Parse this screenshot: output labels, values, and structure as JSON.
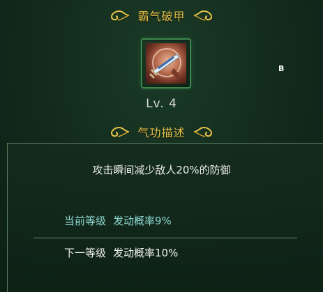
{
  "header": {
    "title": "霸气破甲"
  },
  "skill": {
    "icon": "sword-icon",
    "level": "Lv. 4"
  },
  "marker": "B",
  "section": {
    "title": "气功描述"
  },
  "description": "攻击瞬间减少敌人20%的防御",
  "current": {
    "label": "当前等级",
    "value": "发动概率9%"
  },
  "next": {
    "label": "下一等级",
    "value": "发动概率10%"
  },
  "colors": {
    "title": "#e7c54a",
    "current": "#8fd8d2",
    "frame": "#3f8a4f"
  }
}
